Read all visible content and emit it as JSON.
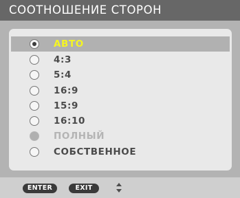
{
  "menu": {
    "title": "СООТНОШЕНИЕ СТОРОН",
    "options": [
      {
        "label": "АВТО",
        "state": "selected"
      },
      {
        "label": "4:3",
        "state": "normal"
      },
      {
        "label": "5:4",
        "state": "normal"
      },
      {
        "label": "16:9",
        "state": "normal"
      },
      {
        "label": "15:9",
        "state": "normal"
      },
      {
        "label": "16:10",
        "state": "normal"
      },
      {
        "label": "ПОЛНЫЙ",
        "state": "disabled"
      },
      {
        "label": "СОБСТВЕННОЕ",
        "state": "normal"
      }
    ],
    "selected_index": 0
  },
  "footer": {
    "enter_label": "ENTER",
    "exit_label": "EXIT",
    "navigation_icon": "up-down-arrows-icon"
  },
  "colors": {
    "title_bar": "#676767",
    "panel": "#b3b3b3",
    "list_background": "#e9e9e9",
    "highlight": "#b1b1b1",
    "selected_text": "#f5f523",
    "footer": "#cfcfcf",
    "key_background": "#3a3a3a"
  }
}
